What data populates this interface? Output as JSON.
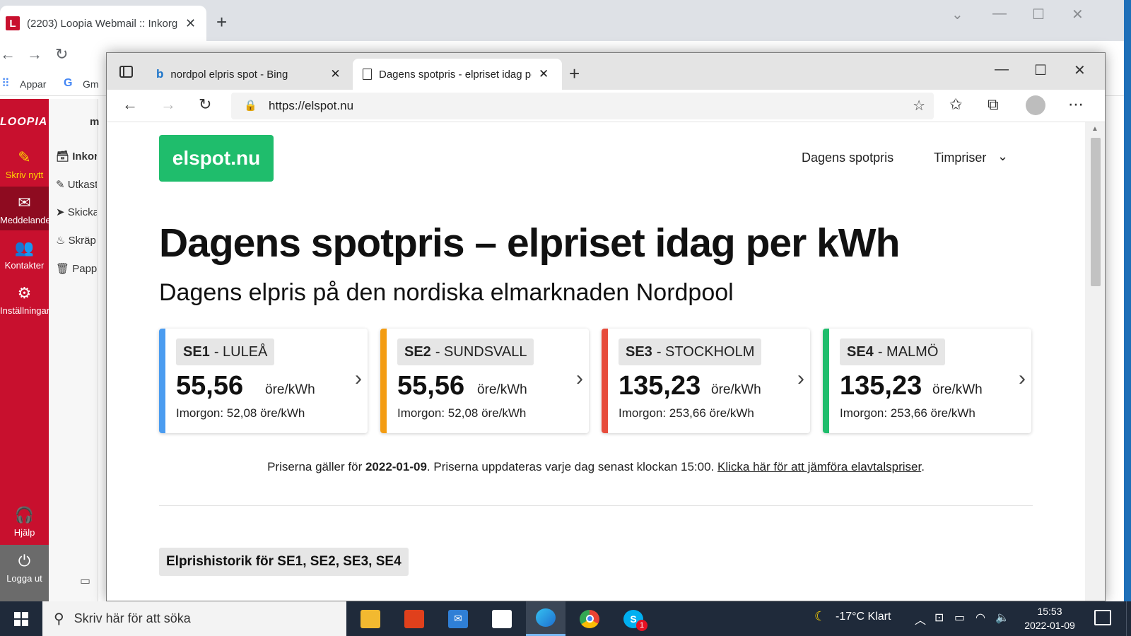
{
  "chrome": {
    "tab_title": "(2203) Loopia Webmail :: Inkorg",
    "bookmarks": {
      "apps": "Appar",
      "gmail": "Gm"
    }
  },
  "loopia": {
    "logo": "LOOPIA",
    "nav": [
      {
        "label": "Skriv nytt",
        "icon": "compose-icon"
      },
      {
        "label": "Meddelanden",
        "icon": "mail-icon"
      },
      {
        "label": "Kontakter",
        "icon": "contacts-icon"
      },
      {
        "label": "Inställningar",
        "icon": "settings-icon"
      }
    ],
    "help": "Hjälp",
    "logout": "Logga ut",
    "folders": [
      "Inkorg",
      "Utkast",
      "Skickat",
      "Skräp",
      "Papperskorg"
    ]
  },
  "edge": {
    "tabs": [
      {
        "title": "nordpol elpris spot - Bing"
      },
      {
        "title": "Dagens spotpris - elpriset idag per kWh"
      }
    ],
    "url": "https://elspot.nu"
  },
  "page": {
    "logo": "elspot.nu",
    "nav": {
      "daily": "Dagens spotpris",
      "hourly": "Timpriser"
    },
    "h1": "Dagens spotpris – elpriset idag per kWh",
    "h2": "Dagens elpris på den nordiska elmarknaden Nordpool",
    "cards": [
      {
        "code": "SE1",
        "city": "- LULEÅ",
        "price": "55,56",
        "unit": "öre/kWh",
        "tomorrow": "Imorgon: 52,08 öre/kWh",
        "color": "#4a9cf0"
      },
      {
        "code": "SE2",
        "city": "- SUNDSVALL",
        "price": "55,56",
        "unit": "öre/kWh",
        "tomorrow": "Imorgon: 52,08 öre/kWh",
        "color": "#f39c12"
      },
      {
        "code": "SE3",
        "city": "- STOCKHOLM",
        "price": "135,23",
        "unit": "öre/kWh",
        "tomorrow": "Imorgon: 253,66 öre/kWh",
        "color": "#e74c3c"
      },
      {
        "code": "SE4",
        "city": "- MALMÖ",
        "price": "135,23",
        "unit": "öre/kWh",
        "tomorrow": "Imorgon: 253,66 öre/kWh",
        "color": "#1fbd6c"
      }
    ],
    "info": {
      "pre": "Priserna gäller för ",
      "date": "2022-01-09",
      "post": ". Priserna uppdateras varje dag senast klockan 15:00. ",
      "link": "Klicka här för att jämföra elavtalspriser",
      "end": "."
    },
    "history_heading": "Elprishistorik för SE1, SE2, SE3, SE4"
  },
  "taskbar": {
    "search_placeholder": "Skriv här för att söka",
    "weather": "-17°C  Klart",
    "time": "15:53",
    "date": "2022-01-09",
    "skype_badge": "1"
  }
}
